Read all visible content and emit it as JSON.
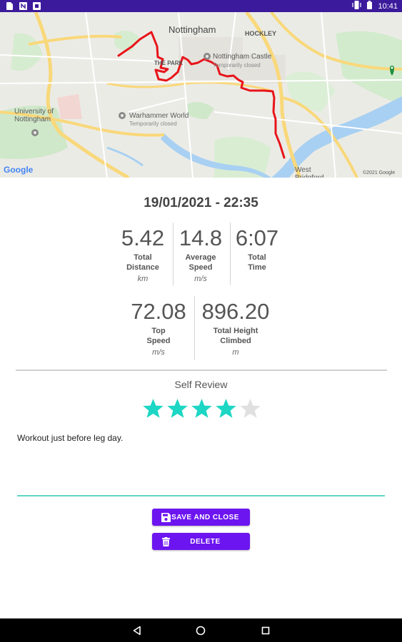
{
  "status_bar": {
    "time": "10:41",
    "left_icons": [
      "file-icon",
      "notification-n-icon",
      "box-icon"
    ],
    "right_icons": [
      "vibrate-icon",
      "battery-icon"
    ]
  },
  "map": {
    "labels": {
      "nottingham": "Nottingham",
      "hockley": "HOCKLEY",
      "castle": "Nottingham Castle",
      "castle_status": "Temporarily closed",
      "the_park": "THE PARK",
      "university": "University of\nNottingham",
      "warhammer": "Warhammer World",
      "warhammer_status": "Temporarily closed",
      "west_bridgford": "West\nBridgford",
      "copyright": "©2021 Google",
      "google": "Google"
    },
    "route_color": "#e8141a"
  },
  "workout": {
    "datetime": "19/01/2021 - 22:35",
    "stats": [
      {
        "value": "5.42",
        "label": "Total\nDistance",
        "unit": "km"
      },
      {
        "value": "14.8",
        "label": "Average\nSpeed",
        "unit": "m/s"
      },
      {
        "value": "6:07",
        "label": "Total\nTime",
        "unit": ""
      },
      {
        "value": "72.08",
        "label": "Top\nSpeed",
        "unit": "m/s"
      },
      {
        "value": "896.20",
        "label": "Total Height\nClimbed",
        "unit": "m"
      }
    ]
  },
  "review": {
    "title": "Self Review",
    "rating": 4,
    "max_rating": 5,
    "star_color": "#1dd6c4",
    "star_empty_color": "#e0e0e0",
    "notes": "Workout just before leg day."
  },
  "actions": {
    "save_label": "SAVE AND CLOSE",
    "delete_label": "DELETE",
    "accent": "#6c15f0"
  },
  "nav": {
    "buttons": [
      "back-icon",
      "home-icon",
      "recents-icon"
    ]
  }
}
